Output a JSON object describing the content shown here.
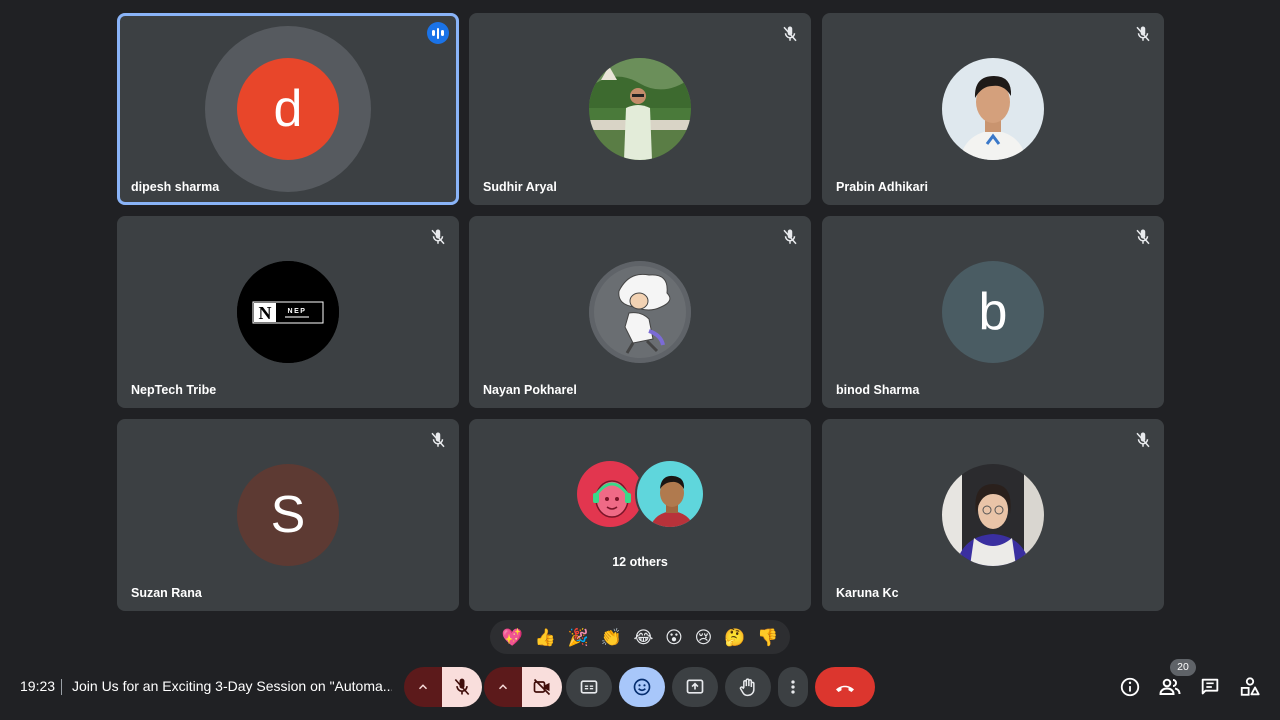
{
  "participants": [
    {
      "name": "dipesh sharma",
      "initial": "d",
      "color": "#e8462a",
      "speaking": true
    },
    {
      "name": "Sudhir Aryal"
    },
    {
      "name": "Prabin Adhikari"
    },
    {
      "name": "NepTech Tribe",
      "logo_text": "NEP"
    },
    {
      "name": "Nayan Pokharel"
    },
    {
      "name": "binod Sharma",
      "initial": "b",
      "color": "#4a5c63"
    },
    {
      "name": "Suzan Rana",
      "initial": "S",
      "color": "#5d3a33"
    },
    {
      "name": "Karuna Kc"
    }
  ],
  "others_tile": {
    "label": "12 others"
  },
  "reactions": [
    "💖",
    "👍",
    "🎉",
    "👏",
    "😂",
    "😮",
    "😢",
    "🤔",
    "👎"
  ],
  "footer": {
    "time": "19:23",
    "meeting_title": "Join Us for an Exciting 3-Day Session on \"Automa...",
    "participant_count": "20"
  },
  "colors": {
    "background": "#202124",
    "tile": "#3c4043",
    "active_border": "#8ab4f8",
    "leave_button": "#dc362e",
    "off_button": "#f9dedc",
    "reaction_button": "#a8c7fa"
  },
  "icons": {
    "mic_button": "mic-off-icon",
    "camera_button": "videocam-off-icon",
    "captions_button": "closed-caption-icon",
    "reactions_button": "emoji-icon",
    "present_button": "present-icon",
    "hand_button": "raise-hand-icon",
    "more_button": "more-vert-icon",
    "leave_button": "call-end-icon",
    "info": "info-icon",
    "people": "people-icon",
    "chat": "chat-icon",
    "activities": "activities-icon"
  }
}
